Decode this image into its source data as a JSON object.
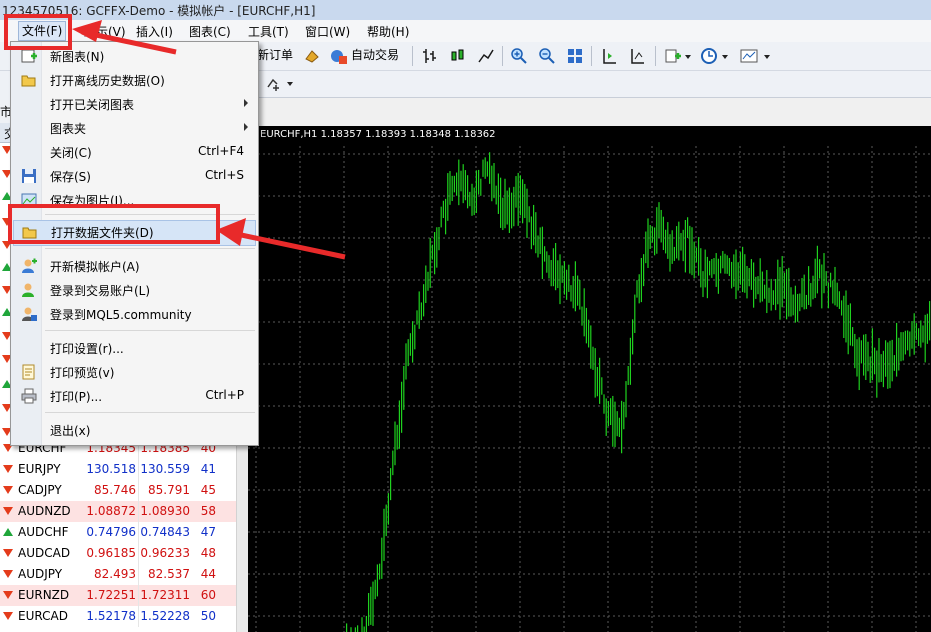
{
  "window": {
    "title": "1234570516: GCFFX-Demo - 模拟帐户 - [EURCHF,H1]"
  },
  "menubar": [
    {
      "label": "文件(F)",
      "active": true
    },
    {
      "label": "显示(V)"
    },
    {
      "label": "插入(I)"
    },
    {
      "label": "图表(C)"
    },
    {
      "label": "工具(T)"
    },
    {
      "label": "窗口(W)"
    },
    {
      "label": "帮助(H)"
    }
  ],
  "toolbar": {
    "new_order": "新订单",
    "auto_trading": "自动交易"
  },
  "file_menu": {
    "items": [
      {
        "label": "新图表(N)",
        "icon": "new-chart-icon"
      },
      {
        "label": "打开离线历史数据(O)",
        "icon": "open-folder-icon"
      },
      {
        "label": "打开已关闭图表",
        "submenu": true
      },
      {
        "label": "图表夹",
        "submenu": true
      },
      {
        "label": "关闭(C)",
        "shortcut": "Ctrl+F4"
      },
      {
        "label": "保存(S)",
        "shortcut": "Ctrl+S",
        "icon": "save-icon"
      },
      {
        "label": "保存为图片(I)...",
        "icon": "save-image-icon"
      },
      {
        "label": "打开数据文件夹(D)",
        "icon": "folder-icon",
        "highlighted": true
      },
      {
        "label": "开新模拟帐户(A)",
        "icon": "new-account-icon"
      },
      {
        "label": "登录到交易账户(L)",
        "icon": "login-icon"
      },
      {
        "label": "登录到MQL5.community",
        "icon": "mql5-icon"
      },
      {
        "label": "打印设置(r)..."
      },
      {
        "label": "打印预览(v)",
        "icon": "print-preview-icon"
      },
      {
        "label": "打印(P)...",
        "shortcut": "Ctrl+P",
        "icon": "printer-icon"
      },
      {
        "label": "退出(x)"
      }
    ]
  },
  "market_watch": {
    "title_fragment": "市",
    "header_fragment": "交",
    "rows": [
      {
        "symbol": "EURCHF",
        "bid": "1.18345",
        "ask": "1.18385",
        "spread": "40",
        "dir": "down",
        "style": "red"
      },
      {
        "symbol": "EURJPY",
        "bid": "130.518",
        "ask": "130.559",
        "spread": "41",
        "dir": "down",
        "style": "blue"
      },
      {
        "symbol": "CADJPY",
        "bid": "85.746",
        "ask": "85.791",
        "spread": "45",
        "dir": "down",
        "style": "red"
      },
      {
        "symbol": "AUDNZD",
        "bid": "1.08872",
        "ask": "1.08930",
        "spread": "58",
        "dir": "down",
        "style": "red_pink"
      },
      {
        "symbol": "AUDCHF",
        "bid": "0.74796",
        "ask": "0.74843",
        "spread": "47",
        "dir": "up",
        "style": "blue"
      },
      {
        "symbol": "AUDCAD",
        "bid": "0.96185",
        "ask": "0.96233",
        "spread": "48",
        "dir": "down",
        "style": "red"
      },
      {
        "symbol": "AUDJPY",
        "bid": "82.493",
        "ask": "82.537",
        "spread": "44",
        "dir": "down",
        "style": "red"
      },
      {
        "symbol": "EURNZD",
        "bid": "1.72251",
        "ask": "1.72311",
        "spread": "60",
        "dir": "down",
        "style": "red_pink"
      },
      {
        "symbol": "EURCAD",
        "bid": "1.52178",
        "ask": "1.52228",
        "spread": "50",
        "dir": "down",
        "style": "blue"
      }
    ]
  },
  "chart": {
    "info": "EURCHF,H1  1.18357 1.18393 1.18348 1.18362",
    "background": "#000000",
    "grid_color": "#5a5a5a",
    "bar_color": "#1fd11f"
  },
  "colors": {
    "annotation": "#e82a2a",
    "highlight": "#d6e5f7"
  }
}
